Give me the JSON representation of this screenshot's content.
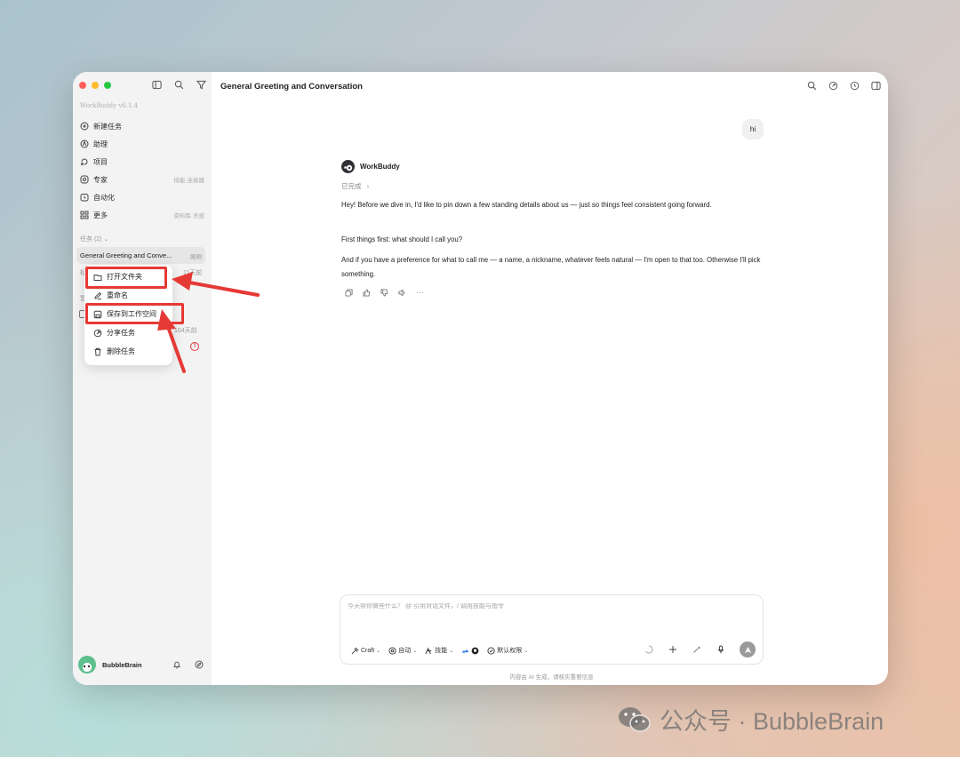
{
  "window": {
    "title": "General Greeting and Conversation",
    "version": "WorkBuddy v6.1.4"
  },
  "sidebar": {
    "nav": [
      {
        "label": "新建任务",
        "icon": "plus-circle-icon",
        "hint": ""
      },
      {
        "label": "助理",
        "icon": "assistant-icon",
        "hint": ""
      },
      {
        "label": "项目",
        "icon": "project-icon",
        "hint": ""
      },
      {
        "label": "专家",
        "icon": "expert-icon",
        "hint": "技能·连接器"
      },
      {
        "label": "自动化",
        "icon": "clock-icon",
        "hint": ""
      },
      {
        "label": "更多",
        "icon": "grid-icon",
        "hint": "资料库·灵感"
      }
    ],
    "section_label": "任务 (2) ⌄",
    "task": {
      "title": "General Greeting and Conve...",
      "meta": "刚刚"
    },
    "behind_texts": {
      "row2_left": "标",
      "row2_right": "11天前",
      "row3_left": "暂",
      "row5_right": "104天前"
    },
    "user": {
      "name": "BubbleBrain"
    }
  },
  "context_menu": {
    "items": [
      {
        "label": "打开文件夹",
        "icon": "folder-icon"
      },
      {
        "label": "重命名",
        "icon": "pencil-icon"
      },
      {
        "label": "保存到工作空间",
        "icon": "save-icon"
      },
      {
        "label": "分享任务",
        "icon": "share-icon"
      },
      {
        "label": "删除任务",
        "icon": "trash-icon"
      }
    ]
  },
  "chat": {
    "user_message": "hi",
    "bot_name": "WorkBuddy",
    "status": "已完成",
    "paragraphs": [
      "Hey! Before we dive in, I'd like to pin down a few standing details about us — just so things feel consistent going forward.",
      "First things first: what should I call you?",
      "And if you have a preference for what to call me — a name, a nickname, whatever feels natural — I'm open to that too. Otherwise I'll pick something."
    ]
  },
  "composer": {
    "placeholder": "今天帮你做些什么？ @ 引用对话文件，/ 调用技能与指令",
    "tools": {
      "craft": "Craft",
      "auto": "自动",
      "skills": "技能",
      "permission": "默认权限"
    },
    "disclaimer": "内容由 AI 生成，请核实重要信息"
  },
  "watermark": {
    "text": "公众号 · BubbleBrain"
  },
  "colors": {
    "highlight_red": "#e53935",
    "traffic_red": "#ff5f57",
    "traffic_yellow": "#febc2e",
    "traffic_green": "#28c840",
    "sidebar_bg": "#f3f3f3"
  }
}
